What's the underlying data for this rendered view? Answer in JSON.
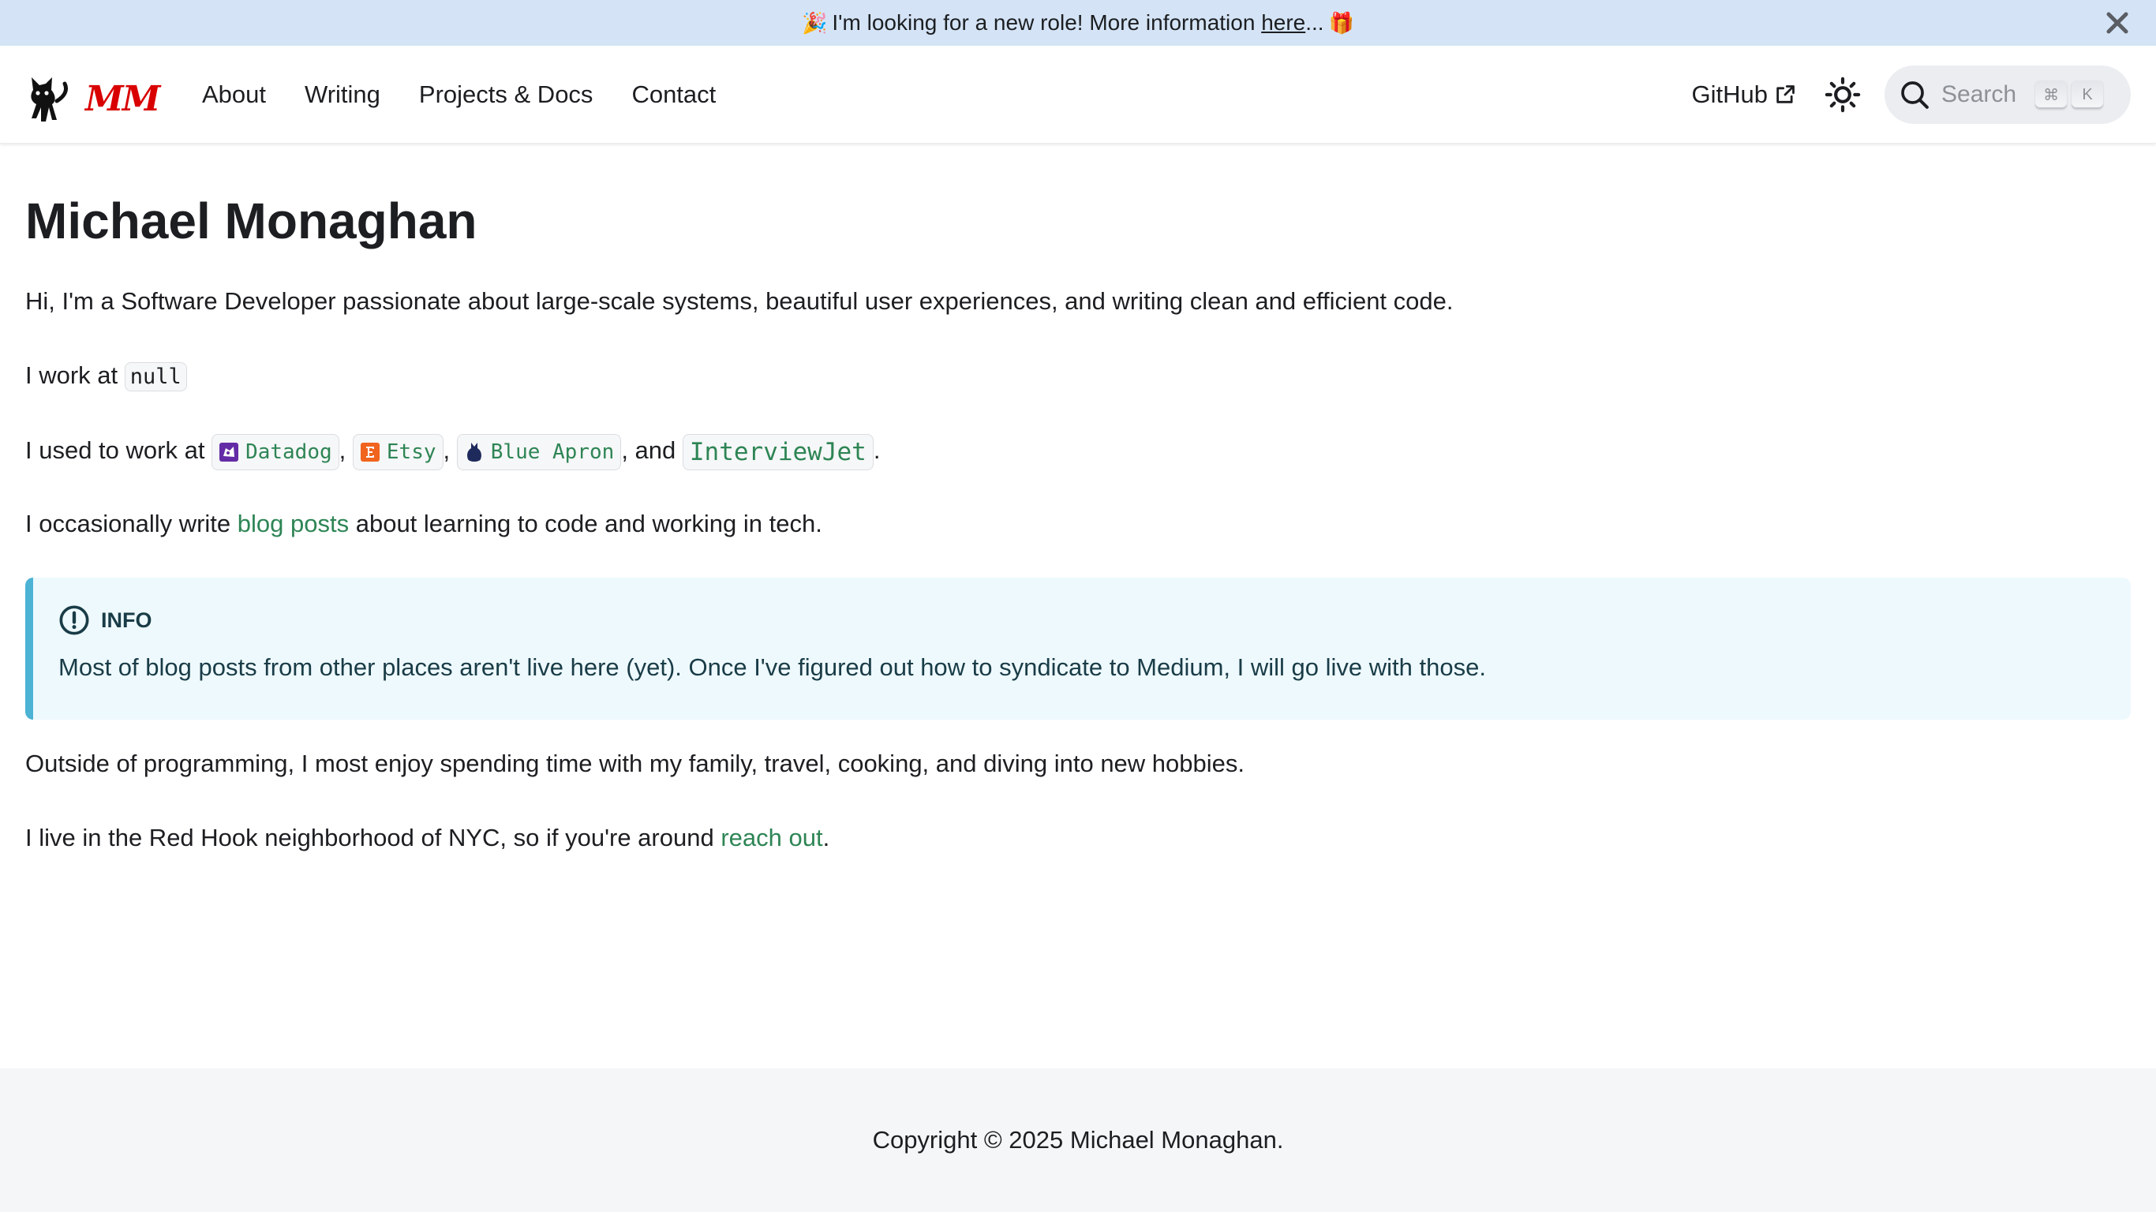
{
  "announcement": {
    "emoji_left": "🎉",
    "text_before": "I'm looking for a new role! More information ",
    "link_text": "here",
    "text_after": "...",
    "emoji_right": "🎁"
  },
  "navbar": {
    "brand_text": "MM",
    "links": [
      "About",
      "Writing",
      "Projects & Docs",
      "Contact"
    ],
    "github_label": "GitHub",
    "search_placeholder": "Search",
    "search_keys": [
      "⌘",
      "K"
    ]
  },
  "page": {
    "title": "Michael Monaghan",
    "intro": "Hi, I'm a Software Developer passionate about large-scale systems, beautiful user experiences, and writing clean and efficient code.",
    "work_prefix": "I work at ",
    "work_current": "null",
    "past_prefix": "I used to work at ",
    "past_companies": [
      "Datadog",
      "Etsy",
      "Blue Apron",
      "InterviewJet"
    ],
    "sep_comma": ",",
    "sep_and": ", and ",
    "sep_period": ".",
    "blog_prefix": "I occasionally write ",
    "blog_link": "blog posts",
    "blog_suffix": " about learning to code and working in tech.",
    "info_title": "INFO",
    "info_body": "Most of blog posts from other places aren't live here (yet). Once I've figured out how to syndicate to Medium, I will go live with those.",
    "hobbies": "Outside of programming, I most enjoy spending time with my family, travel, cooking, and diving into new hobbies.",
    "location_prefix": "I live in the Red Hook neighborhood of NYC, so if you're around ",
    "location_link": "reach out",
    "location_suffix": "."
  },
  "footer": {
    "copyright": "Copyright © 2025 Michael Monaghan."
  },
  "colors": {
    "announcement_bg": "#d4e4f6",
    "link_green": "#2e8555",
    "brand_red": "#d90000",
    "info_border": "#4cb3d4",
    "info_bg": "#eef9fd",
    "footer_bg": "#f5f6f7"
  },
  "icons": {
    "close": "close-icon",
    "external": "external-link-icon",
    "theme": "sun-icon",
    "search": "search-icon",
    "info": "info-icon",
    "datadog": "datadog-logo-icon",
    "etsy": "etsy-logo-icon",
    "blue_apron": "blue-apron-logo-icon"
  }
}
